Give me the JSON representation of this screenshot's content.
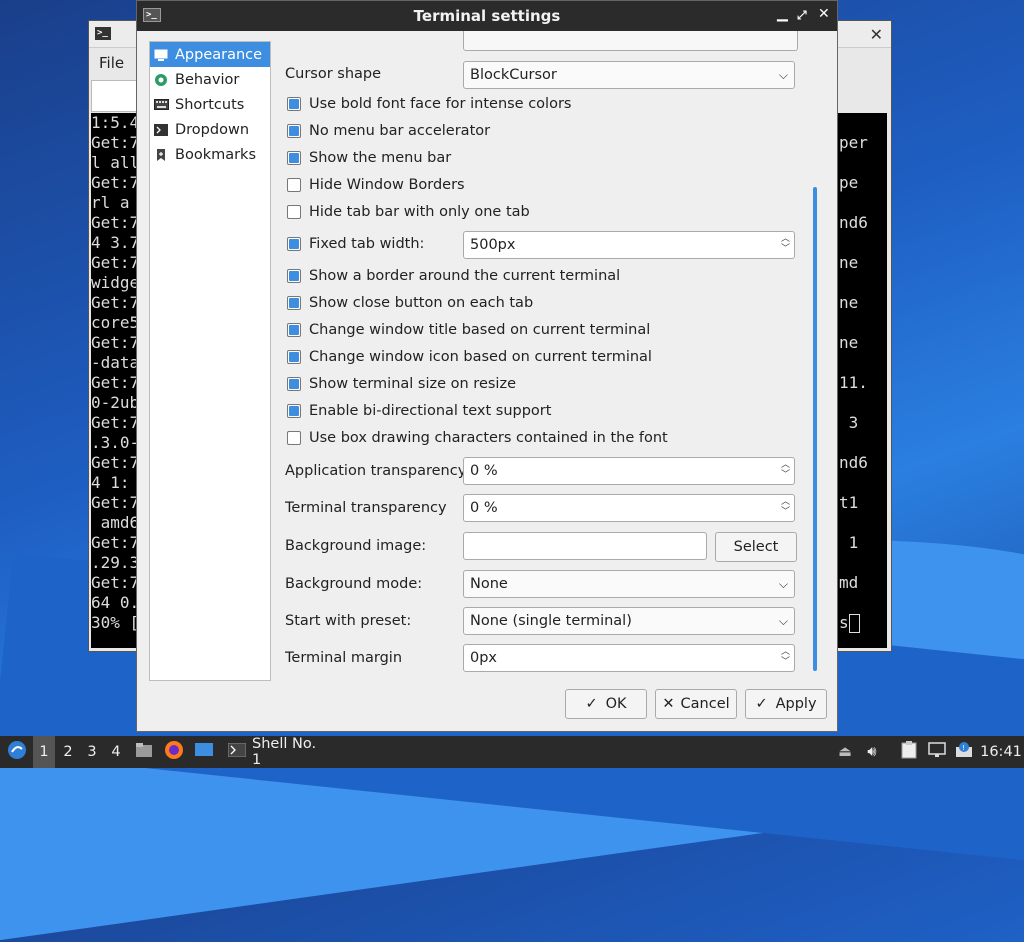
{
  "background_terminal": {
    "menu_file": "File",
    "left_lines": [
      "1:5.4",
      "Get:7",
      "l all",
      "Get:7",
      "rl a",
      "Get:7",
      "4 3.7",
      "Get:7",
      "widge",
      "Get:7",
      "core5",
      "Get:7",
      "-data",
      "Get:7",
      "0-2ub",
      "Get:7",
      ".3.0-",
      "Get:7",
      "4 1:",
      "Get:7",
      " amd6",
      "Get:7",
      ".29.3",
      "Get:7",
      "64 0.",
      "30% ["
    ],
    "right_lines": [
      "per",
      "pe",
      "nd6",
      "ne",
      "ne",
      "ne",
      "11.",
      " 3",
      "nd6",
      "t1",
      " 1",
      "md",
      "s"
    ]
  },
  "dialog": {
    "title": "Terminal settings",
    "sidebar": [
      {
        "label": "Appearance",
        "icon": "appearance-icon",
        "selected": true
      },
      {
        "label": "Behavior",
        "icon": "behavior-icon",
        "selected": false
      },
      {
        "label": "Shortcuts",
        "icon": "keyboard-icon",
        "selected": false
      },
      {
        "label": "Dropdown",
        "icon": "terminal-icon",
        "selected": false
      },
      {
        "label": "Bookmarks",
        "icon": "bookmark-icon",
        "selected": false
      }
    ],
    "cursor_shape": {
      "label": "Cursor shape",
      "value": "BlockCursor"
    },
    "checks": [
      {
        "label": "Use bold font face for intense colors",
        "checked": true
      },
      {
        "label": "No menu bar accelerator",
        "checked": true
      },
      {
        "label": "Show the menu bar",
        "checked": true
      },
      {
        "label": "Hide Window Borders",
        "checked": false
      },
      {
        "label": "Hide tab bar with only one tab",
        "checked": false
      }
    ],
    "fixed_tab_width": {
      "label": "Fixed tab width:",
      "checked": true,
      "value": "500px"
    },
    "checks2": [
      {
        "label": "Show a border around the current terminal",
        "checked": true
      },
      {
        "label": "Show close button on each tab",
        "checked": true
      },
      {
        "label": "Change window title based on current terminal",
        "checked": true
      },
      {
        "label": "Change window icon based on current terminal",
        "checked": true
      },
      {
        "label": "Show terminal size on resize",
        "checked": true
      },
      {
        "label": "Enable bi-directional text support",
        "checked": true
      },
      {
        "label": "Use box drawing characters contained in the font",
        "checked": false
      }
    ],
    "app_transparency": {
      "label": "Application transparency",
      "value": "0 %"
    },
    "term_transparency": {
      "label": "Terminal transparency",
      "value": "0 %"
    },
    "bg_image": {
      "label": "Background image:",
      "value": "",
      "button": "Select"
    },
    "bg_mode": {
      "label": "Background mode:",
      "value": "None"
    },
    "preset": {
      "label": "Start with preset:",
      "value": "None (single terminal)"
    },
    "margin": {
      "label": "Terminal margin",
      "value": "0px"
    },
    "buttons": {
      "ok": "OK",
      "cancel": "Cancel",
      "apply": "Apply"
    }
  },
  "taskbar": {
    "workspaces": [
      "1",
      "2",
      "3",
      "4"
    ],
    "task_label": "Shell No. 1",
    "clock": "16:41"
  },
  "colors": {
    "accent": "#3d8ee0",
    "titlebar": "#2b2b2b",
    "taskbar": "#2a2a2a"
  }
}
